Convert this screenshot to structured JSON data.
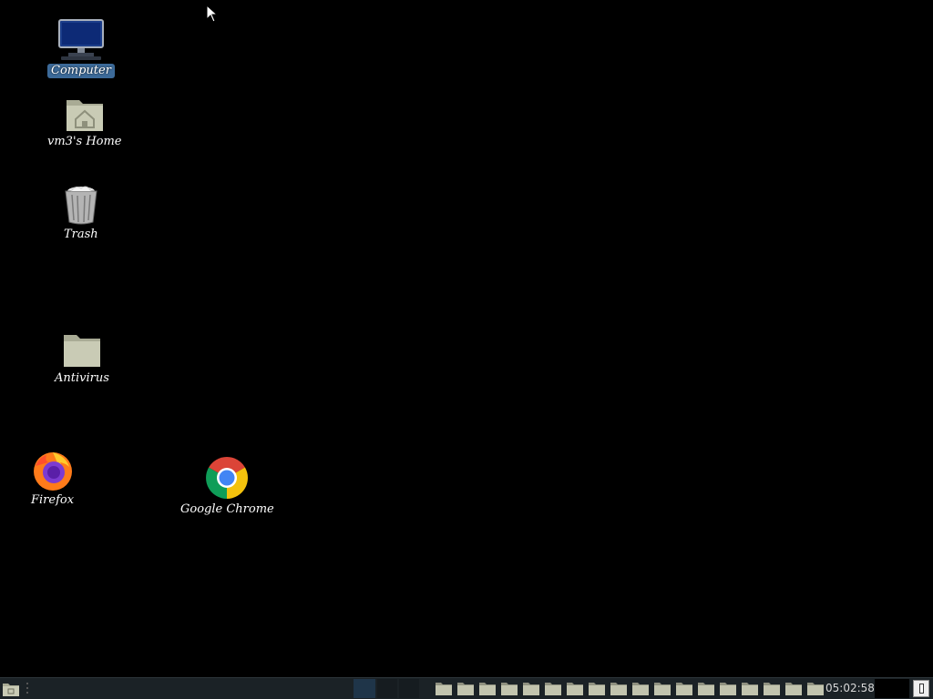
{
  "desktop": {
    "icons": [
      {
        "label": "Computer",
        "icon": "computer-icon",
        "selected": true
      },
      {
        "label": "vm3's Home",
        "icon": "home-folder-icon"
      },
      {
        "label": "Trash",
        "icon": "trash-icon"
      },
      {
        "label": "Antivirus",
        "icon": "folder-icon"
      },
      {
        "label": "Firefox",
        "icon": "firefox-icon"
      },
      {
        "label": "Google Chrome",
        "icon": "chrome-icon"
      }
    ]
  },
  "taskbar": {
    "clock": "05:02:58",
    "folder_launcher_count": 18
  },
  "colors": {
    "background": "#000000",
    "taskbar": "#1b2226",
    "selection": "#3c6a99"
  }
}
